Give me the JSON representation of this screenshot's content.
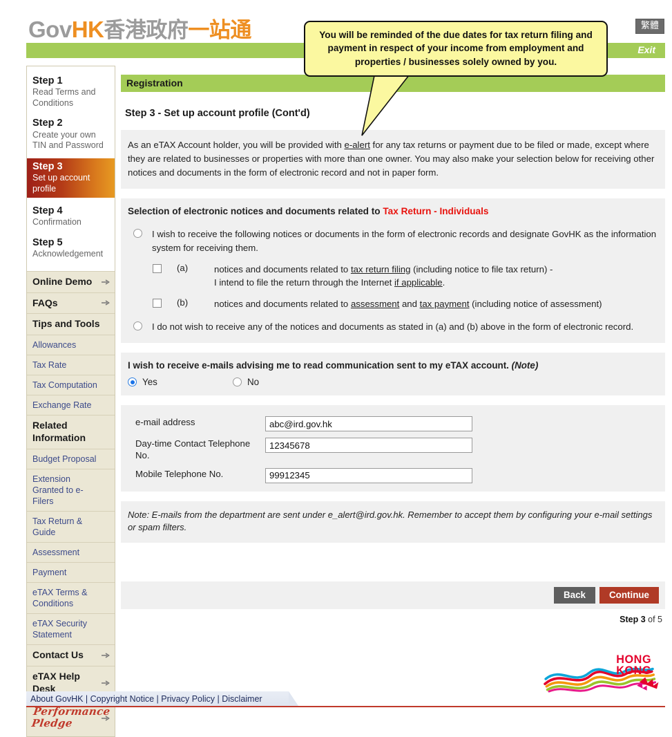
{
  "header": {
    "logo_gov": "Gov",
    "logo_hk": "HK",
    "logo_cn_gray": "香港政府",
    "logo_cn_orange": "一站通",
    "lang_toggle": "繁體",
    "exit_label": "Exit"
  },
  "callout": {
    "text": "You will be reminded of the due dates for tax return filing and payment in respect of your income from employment and properties / businesses solely owned by you."
  },
  "sidebar": {
    "steps": [
      {
        "title": "Step 1",
        "subtitle": "Read Terms and Conditions",
        "active": false
      },
      {
        "title": "Step 2",
        "subtitle": "Create your own TIN and Password",
        "active": false
      },
      {
        "title": "Step 3",
        "subtitle": "Set up account profile",
        "active": true
      },
      {
        "title": "Step 4",
        "subtitle": "Confirmation",
        "active": false
      },
      {
        "title": "Step 5",
        "subtitle": "Acknowledgement",
        "active": false
      }
    ],
    "nav": [
      {
        "label": "Online Demo",
        "type": "head",
        "arrow": true
      },
      {
        "label": "FAQs",
        "type": "head",
        "arrow": true
      },
      {
        "label": "Tips and Tools",
        "type": "head",
        "arrow": false
      },
      {
        "label": "Allowances",
        "type": "sub",
        "arrow": false
      },
      {
        "label": "Tax Rate",
        "type": "sub",
        "arrow": false
      },
      {
        "label": "Tax Computation",
        "type": "sub",
        "arrow": false
      },
      {
        "label": "Exchange Rate",
        "type": "sub",
        "arrow": false
      },
      {
        "label": "Related Information",
        "type": "head",
        "arrow": false
      },
      {
        "label": "Budget Proposal",
        "type": "sub",
        "arrow": false
      },
      {
        "label": "Extension Granted to e-Filers",
        "type": "sub",
        "arrow": false
      },
      {
        "label": "Tax Return & Guide",
        "type": "sub",
        "arrow": false
      },
      {
        "label": "Assessment",
        "type": "sub",
        "arrow": false
      },
      {
        "label": "Payment",
        "type": "sub",
        "arrow": false
      },
      {
        "label": "eTAX Terms & Conditions",
        "type": "sub",
        "arrow": false
      },
      {
        "label": "eTAX Security Statement",
        "type": "sub",
        "arrow": false
      },
      {
        "label": "Contact Us",
        "type": "head",
        "arrow": true
      },
      {
        "label": "eTAX Help Desk",
        "type": "head",
        "arrow": true
      },
      {
        "label": "Performance Pledge",
        "type": "pledge",
        "arrow": true
      }
    ]
  },
  "main": {
    "section_bar": "Registration",
    "page_title": "Step 3 - Set up account profile (Cont'd)",
    "intro_part1": "As an eTAX Account holder, you will be provided with ",
    "intro_link": "e-alert",
    "intro_part2": " for any tax returns or payment due to be filed or made, except where they are related to businesses or properties with more than one owner. You may also make your selection below for receiving other notices and documents in the form of electronic record and not in paper form.",
    "selection_title_plain": "Selection of electronic notices and documents related to ",
    "selection_title_red": "Tax Return - Individuals",
    "option1_text": "I wish to receive the following notices or documents in the form of electronic records and designate GovHK as the information system for receiving them.",
    "option1_checked": false,
    "sub_a": {
      "marker": "(a)",
      "checked": false,
      "t1": "notices and documents related to ",
      "link1": "tax return filing",
      "t2": " (including notice to file tax return) -",
      "t3": "I intend to file the return through the Internet ",
      "link2": "if applicable",
      "t4": "."
    },
    "sub_b": {
      "marker": "(b)",
      "checked": false,
      "t1": "notices and documents related to ",
      "link1": "assessment",
      "t2": " and ",
      "link2": "tax payment",
      "t3": " (including notice of assessment)"
    },
    "option2_text": "I do not wish to receive any of the notices and documents as stated in (a) and (b) above in the form of electronic record.",
    "option2_checked": false,
    "email_question_main": "I wish to receive e-mails advising me to read communication sent to my eTAX account. ",
    "email_question_note": "(Note)",
    "yes_label": "Yes",
    "no_label": "No",
    "yes_selected": true,
    "no_selected": false,
    "fields": [
      {
        "label": "e-mail address",
        "value": "abc@ird.gov.hk"
      },
      {
        "label": "Day-time Contact Telephone No.",
        "value": "12345678"
      },
      {
        "label": "Mobile Telephone No.",
        "value": "99912345"
      }
    ],
    "note_text": "Note: E-mails from the department are sent under e_alert@ird.gov.hk. Remember to accept them by configuring your e-mail settings or spam filters.",
    "back_label": "Back",
    "continue_label": "Continue",
    "step_of_prefix": "Step ",
    "step_of_number": "3",
    "step_of_suffix": " of 5"
  },
  "footer": {
    "links": [
      "About GovHK",
      "Copyright Notice",
      "Privacy Policy",
      "Disclaimer"
    ],
    "separator": " | ",
    "brand_line1": "HONG",
    "brand_line2": "KONG"
  },
  "colors": {
    "green": "#a4cc57",
    "accent_red": "#b03a26",
    "callout_yellow": "#fbf8a0",
    "sidebar_beige": "#ebe7d5",
    "panel_gray": "#f0f0f0",
    "link_blue": "#3c4a8a",
    "highlight_red": "#e8140f"
  }
}
